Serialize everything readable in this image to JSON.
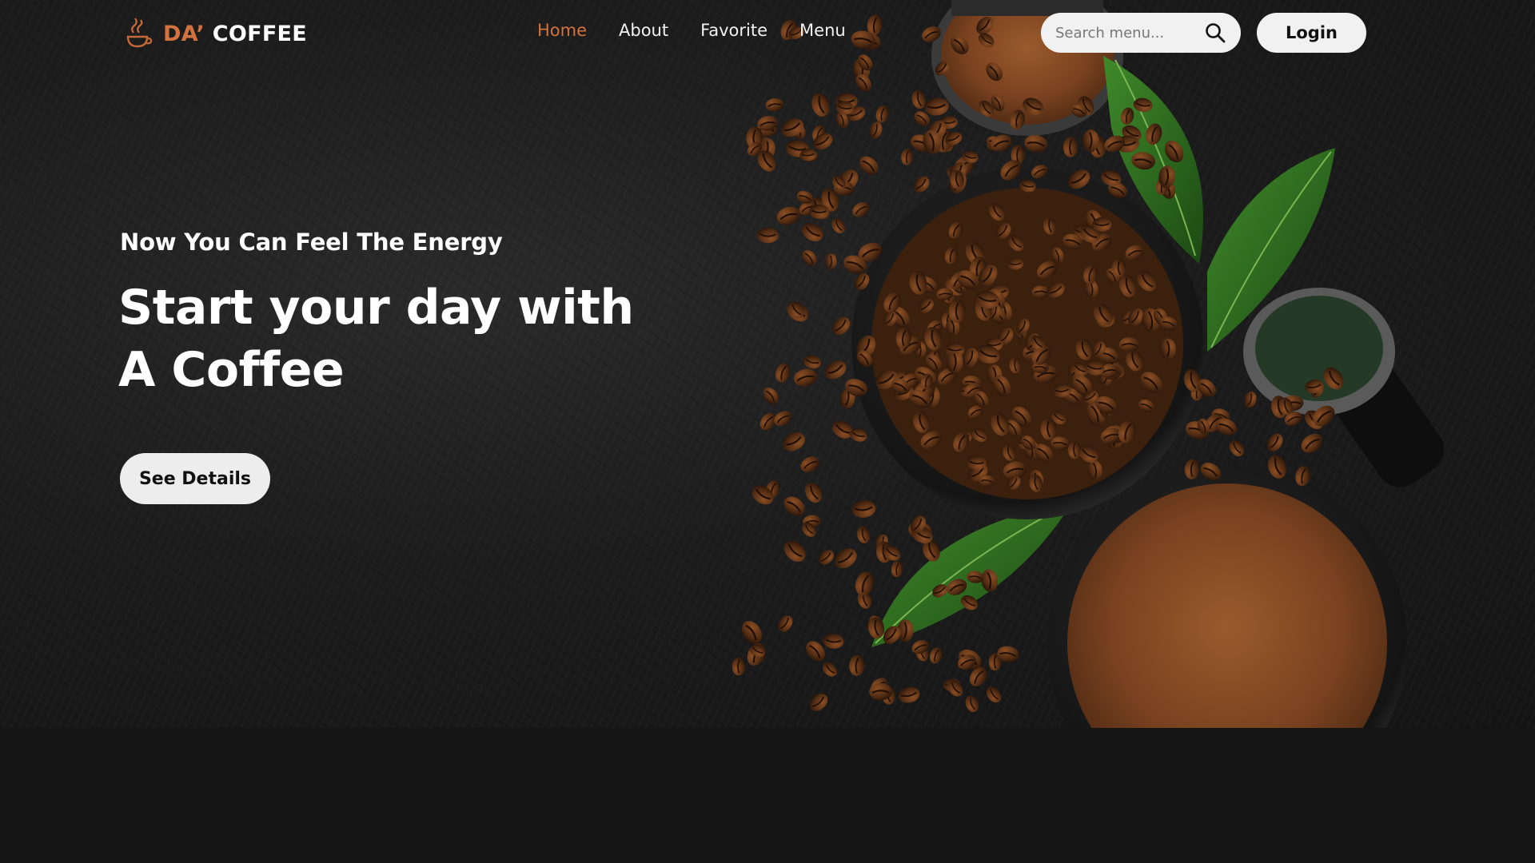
{
  "brand": {
    "accent": "DA’",
    "name": "COFFEE",
    "accent_color": "#d2733f",
    "logo_icon": "coffee-cup-logo-icon"
  },
  "nav": {
    "items": [
      {
        "label": "Home",
        "active": true
      },
      {
        "label": "About",
        "active": false
      },
      {
        "label": "Favorite",
        "active": false
      },
      {
        "label": "Menu",
        "active": false
      }
    ]
  },
  "search": {
    "placeholder": "Search menu...",
    "value": "",
    "icon": "search-icon"
  },
  "login": {
    "label": "Login"
  },
  "hero": {
    "tagline": "Now You Can Feel The Energy",
    "headline_line1": "Start your day with",
    "headline_line2": "A Coffee",
    "cta_label": "See Details",
    "image": "coffee-beans-and-ground-coffee-bowls-with-leaves"
  },
  "colors": {
    "background": "#141414",
    "button": "#ededed",
    "active_nav": "#d2733f"
  }
}
